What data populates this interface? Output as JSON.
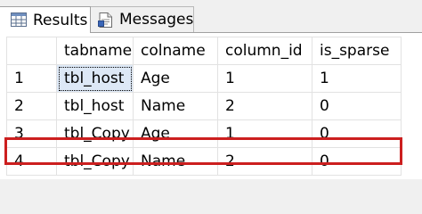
{
  "tabs": [
    {
      "label": "Results",
      "icon": "grid-icon",
      "active": true
    },
    {
      "label": "Messages",
      "icon": "messages-icon",
      "active": false
    }
  ],
  "grid": {
    "columns": [
      "tabname",
      "colname",
      "column_id",
      "is_sparse"
    ],
    "rows": [
      {
        "num": "1",
        "cells": [
          "tbl_host",
          "Age",
          "1",
          "1"
        ]
      },
      {
        "num": "2",
        "cells": [
          "tbl_host",
          "Name",
          "2",
          "0"
        ]
      },
      {
        "num": "3",
        "cells": [
          "tbl_Copy",
          "Age",
          "1",
          "0"
        ]
      },
      {
        "num": "4",
        "cells": [
          "tbl_Copy",
          "Name",
          "2",
          "0"
        ]
      }
    ],
    "highlighted_row": "3"
  },
  "colors": {
    "highlight_border": "#cc1f1f",
    "selected_cell": "#dde8f6"
  }
}
